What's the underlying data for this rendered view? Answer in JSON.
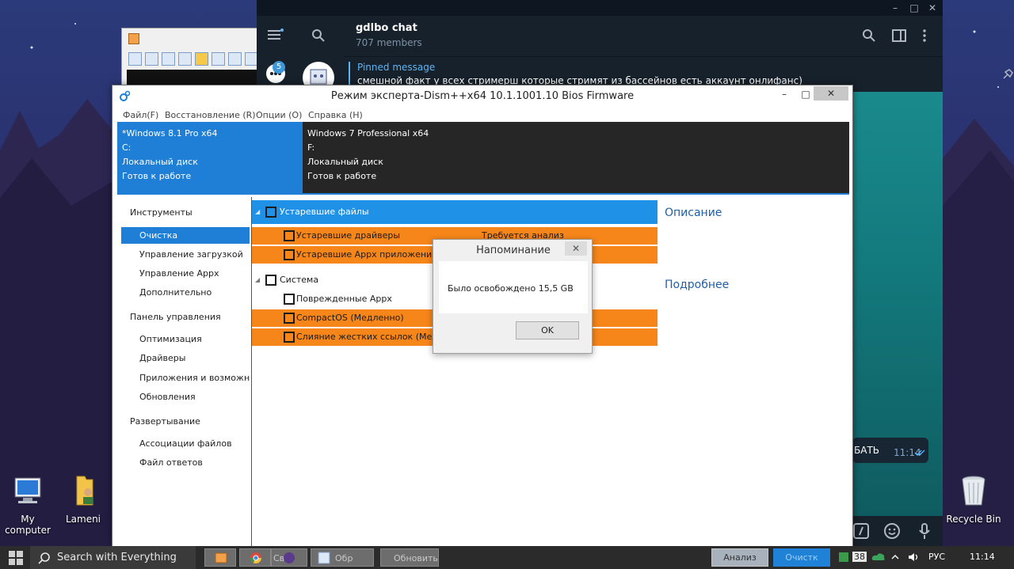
{
  "desktop": {
    "icons": [
      {
        "label_line1": "My",
        "label_line2": "computer"
      },
      {
        "label_line1": "Lameni",
        "label_line2": ""
      },
      {
        "label_line1": "Recycle Bin",
        "label_line2": ""
      }
    ]
  },
  "telegram": {
    "chat_title": "gdlbo chat",
    "members": "707 members",
    "unread_badge": "5",
    "pinned_label": "Pinned message",
    "pinned_text": "смешной факт  у всех стримерш которые стримят из бассейнов есть аккаунт онлифанс)",
    "message_fragment": "БАТЬ",
    "message_time": "11:14",
    "window_controls": [
      "–",
      "□",
      "✕"
    ]
  },
  "dism": {
    "title": "Режим эксперта-Dism++x64 10.1.1001.10 Bios Firmware",
    "controls": {
      "minimize": "–",
      "maximize": "□",
      "close": "✕"
    },
    "menu": [
      "Файл(F)",
      "Восстановление (R)",
      "Опции (O)",
      "Справка (H)"
    ],
    "drives": [
      {
        "os": "*Windows 8.1 Pro x64",
        "letter": "C:",
        "type": "Локальный диск",
        "status": "Готов к работе"
      },
      {
        "os": "Windows 7 Professional x64",
        "letter": "F:",
        "type": "Локальный диск",
        "status": "Готов к работе"
      }
    ],
    "nav": {
      "section_tools": "Инструменты",
      "item_cleanup": "Очистка",
      "item_boot": "Управление загрузкой",
      "item_appx": "Управление Appx",
      "item_extra": "Дополнительно",
      "section_control": "Панель управления",
      "item_optimize": "Оптимизация",
      "item_drivers": "Драйверы",
      "item_apps": "Приложения и возможности",
      "item_updates": "Обновления",
      "section_deploy": "Развертывание",
      "item_assoc": "Ассоциации файлов",
      "item_answer": "Файл ответов"
    },
    "list": {
      "group_outdated": "Устаревшие файлы",
      "outdated_drivers": "Устаревшие драйверы",
      "analysis_required": "Требуется анализ",
      "outdated_appx": "Устаревшие Appx приложения",
      "group_system": "Система",
      "damaged_appx": "Поврежденные Appx",
      "compactos": "CompactOS (Медленно)",
      "hardlinks": "Слияние жестких ссылок (Медленно)"
    },
    "description_title": "Описание",
    "details_title": "Подробнее",
    "dialog": {
      "title": "Напоминание",
      "close": "✕",
      "message": "Было освобождено 15,5 GB",
      "ok": "OK"
    }
  },
  "taskbar": {
    "search": "Search with Everything",
    "app_labels": [
      "Свя",
      "Обр",
      "Обновить"
    ],
    "analyze": "Анализ",
    "clean": "Очистк",
    "tray_badge": "38",
    "language": "РУС",
    "clock": "11:14"
  }
}
